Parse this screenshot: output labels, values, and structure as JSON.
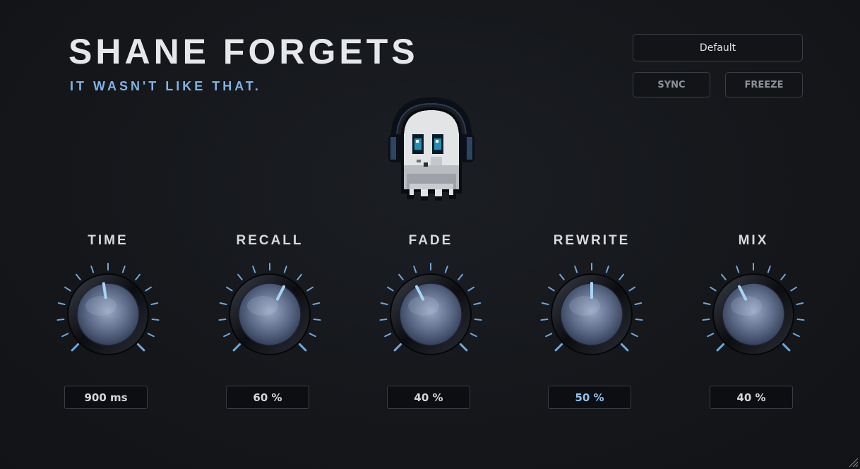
{
  "header": {
    "title": "SHANE FORGETS",
    "subtitle": "IT WASN'T LIKE THAT."
  },
  "controls": {
    "preset_label": "Default",
    "sync_label": "SYNC",
    "freeze_label": "FREEZE"
  },
  "mascot": {
    "icon": "ghost-with-headphones-icon"
  },
  "colors": {
    "accent": "#7fb3e6",
    "tick": "#6fa8dc",
    "knob_pointer": "#a9d4f5",
    "background": "#16181c"
  },
  "knobs": [
    {
      "label": "TIME",
      "value_text": "900 ms",
      "position": 0.47,
      "active": false
    },
    {
      "label": "RECALL",
      "value_text": "60 %",
      "position": 0.6,
      "active": false
    },
    {
      "label": "FADE",
      "value_text": "40 %",
      "position": 0.4,
      "active": false
    },
    {
      "label": "REWRITE",
      "value_text": "50 %",
      "position": 0.5,
      "active": true
    },
    {
      "label": "MIX",
      "value_text": "40 %",
      "position": 0.4,
      "active": false
    }
  ]
}
